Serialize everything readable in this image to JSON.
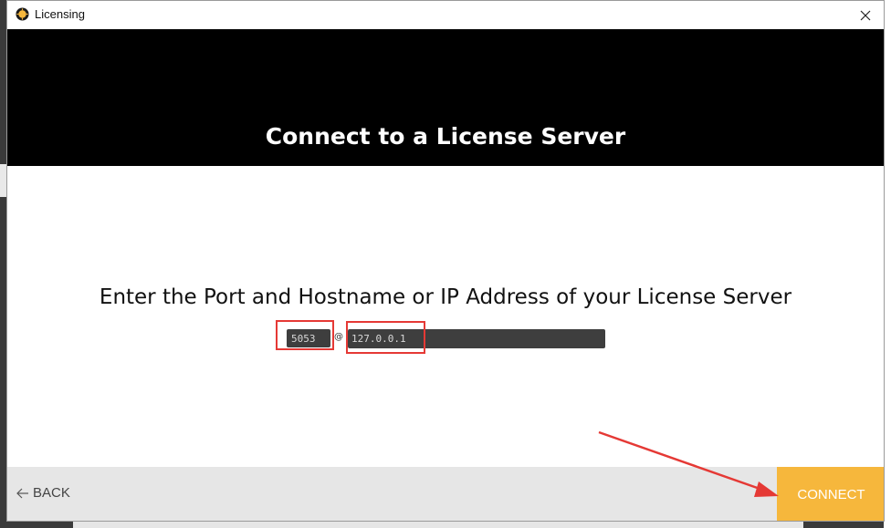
{
  "window": {
    "title": "Licensing"
  },
  "banner": {
    "title": "Connect to a License Server"
  },
  "form": {
    "prompt": "Enter the Port and Hostname or IP Address of your License Server",
    "port_value": "5053",
    "at_symbol": "@",
    "host_value": "127.0.0.1"
  },
  "footer": {
    "back_label": "BACK",
    "connect_label": "CONNECT"
  },
  "icons": {
    "app": "app-logo-icon",
    "close": "close-icon",
    "back": "arrow-left-icon"
  },
  "colors": {
    "banner_bg": "#000000",
    "input_bg": "#3e3e3e",
    "footer_bg": "#e6e6e6",
    "connect_bg": "#f6b73c",
    "annotation": "#e53935"
  }
}
